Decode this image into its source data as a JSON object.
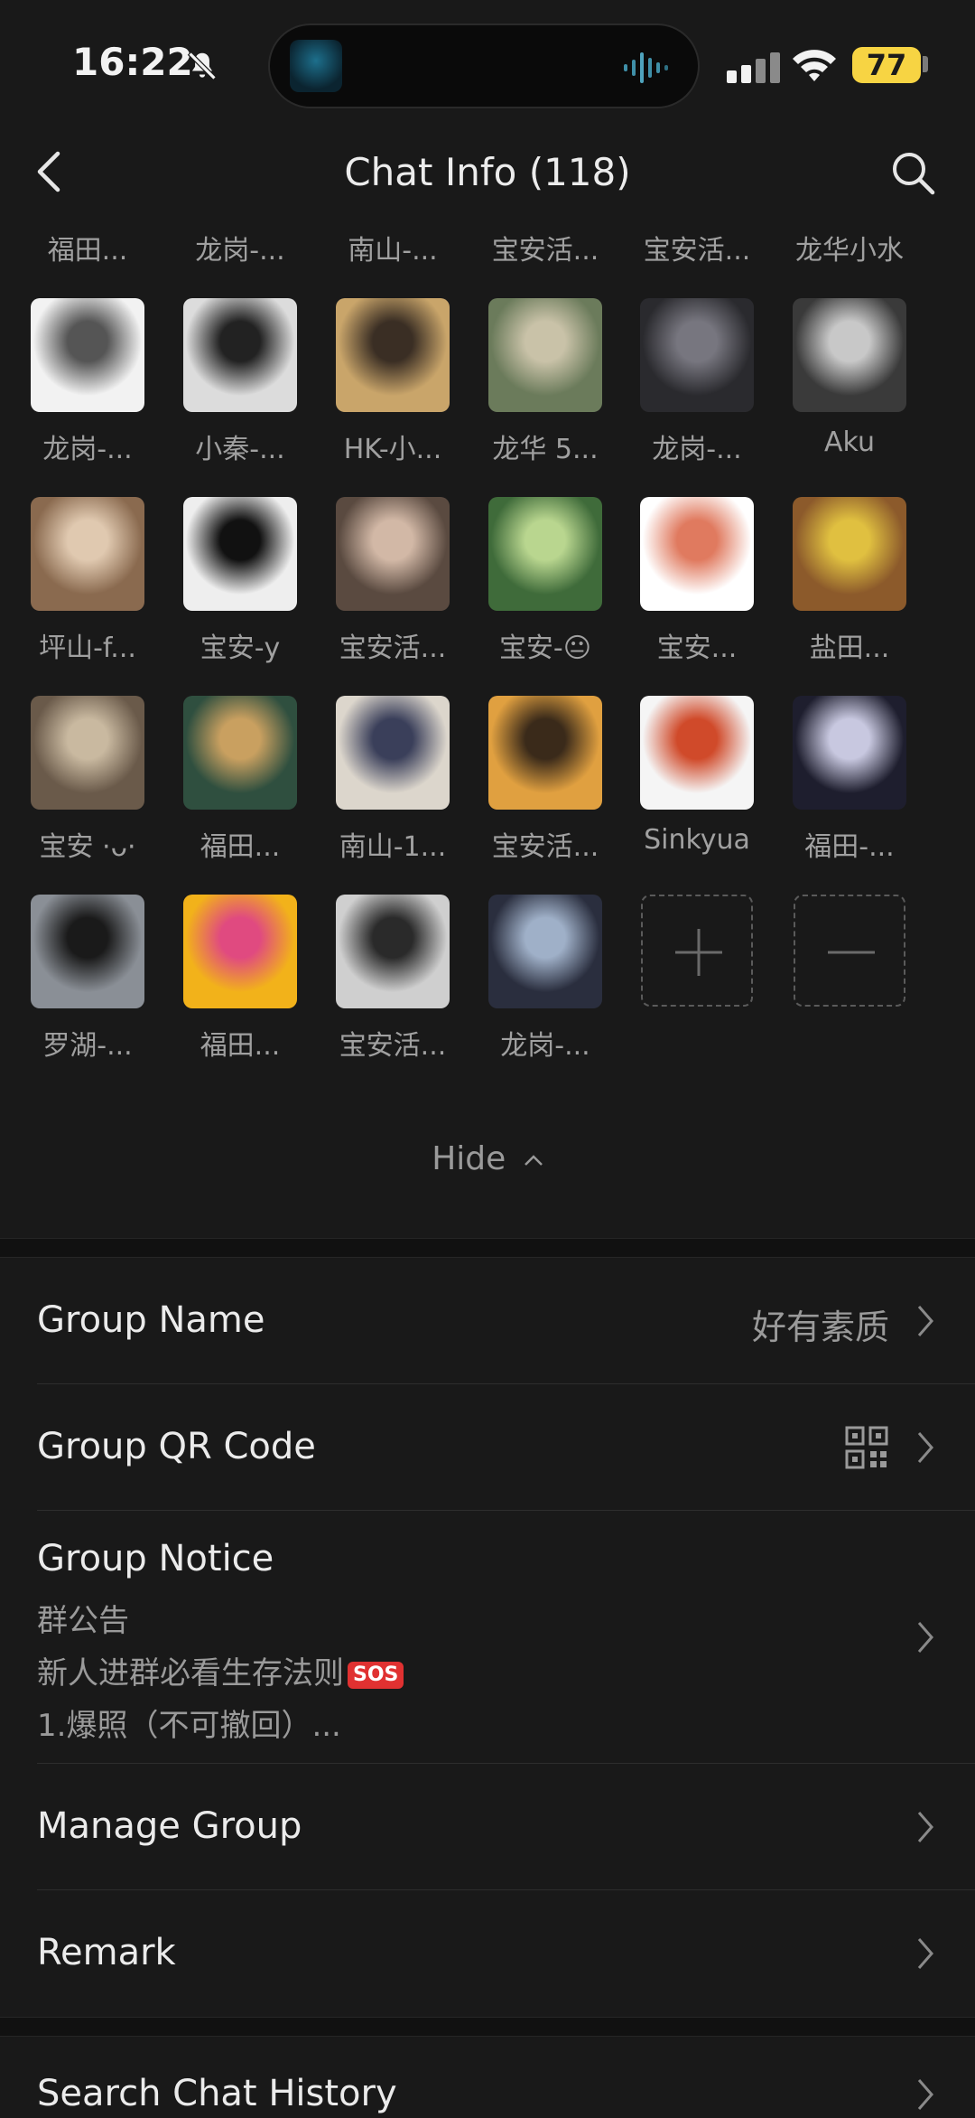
{
  "status_bar": {
    "time": "16:22",
    "battery": "77"
  },
  "nav": {
    "title": "Chat Info (118)"
  },
  "members": [
    {
      "name": "福田..."
    },
    {
      "name": "龙岗-..."
    },
    {
      "name": "南山-..."
    },
    {
      "name": "宝安活..."
    },
    {
      "name": "宝安活..."
    },
    {
      "name": "龙华小水"
    },
    {
      "name": "龙岗-..."
    },
    {
      "name": "小秦-..."
    },
    {
      "name": "HK-小..."
    },
    {
      "name": "龙华 5..."
    },
    {
      "name": "龙岗-..."
    },
    {
      "name": "Aku"
    },
    {
      "name": "坪山-f..."
    },
    {
      "name": "宝安-y"
    },
    {
      "name": "宝安活..."
    },
    {
      "name": "宝安-😐"
    },
    {
      "name": "宝安..."
    },
    {
      "name": "盐田..."
    },
    {
      "name": "宝安 ·ᴗ·"
    },
    {
      "name": "福田..."
    },
    {
      "name": "南山-1..."
    },
    {
      "name": "宝安活..."
    },
    {
      "name": "Sinkyua"
    },
    {
      "name": "福田-..."
    },
    {
      "name": "罗湖-..."
    },
    {
      "name": "福田..."
    },
    {
      "name": "宝安活..."
    },
    {
      "name": "龙岗-..."
    }
  ],
  "hide_label": "Hide",
  "settings": {
    "group_name": {
      "label": "Group Name",
      "value": "好有素质"
    },
    "group_qr": {
      "label": "Group QR Code"
    },
    "group_notice": {
      "label": "Group Notice",
      "line1": "群公告",
      "line2": "新人进群必看生存法则",
      "badge": "SOS",
      "line3": "1.爆照（不可撤回）..."
    },
    "manage_group": {
      "label": "Manage Group"
    },
    "remark": {
      "label": "Remark"
    },
    "search_history": {
      "label": "Search Chat History"
    }
  }
}
